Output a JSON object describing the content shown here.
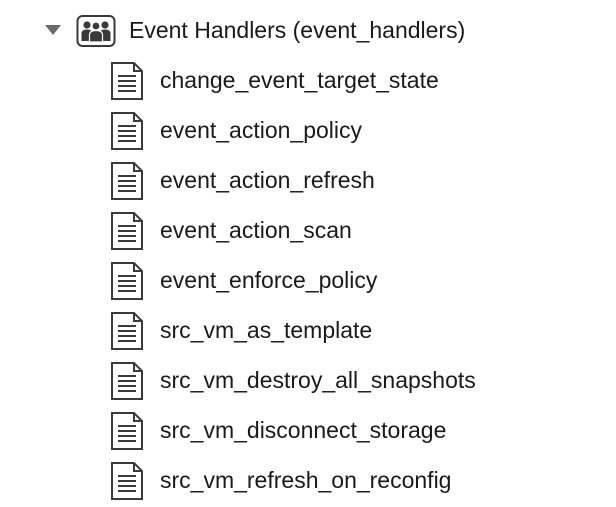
{
  "tree": {
    "parent": {
      "label": "Event Handlers (event_handlers)",
      "expanded": true,
      "expander_icon": "triangle-down-icon",
      "icon": "group-folder-icon"
    },
    "children": [
      {
        "label": "change_event_target_state",
        "icon": "document-icon"
      },
      {
        "label": "event_action_policy",
        "icon": "document-icon"
      },
      {
        "label": "event_action_refresh",
        "icon": "document-icon"
      },
      {
        "label": "event_action_scan",
        "icon": "document-icon"
      },
      {
        "label": "event_enforce_policy",
        "icon": "document-icon"
      },
      {
        "label": "src_vm_as_template",
        "icon": "document-icon"
      },
      {
        "label": "src_vm_destroy_all_snapshots",
        "icon": "document-icon"
      },
      {
        "label": "src_vm_disconnect_storage",
        "icon": "document-icon"
      },
      {
        "label": "src_vm_refresh_on_reconfig",
        "icon": "document-icon"
      }
    ]
  },
  "colors": {
    "text": "#1a1a1a",
    "icon_stroke": "#3a3a3a",
    "expander": "#6a6a6a",
    "background": "#ffffff"
  }
}
